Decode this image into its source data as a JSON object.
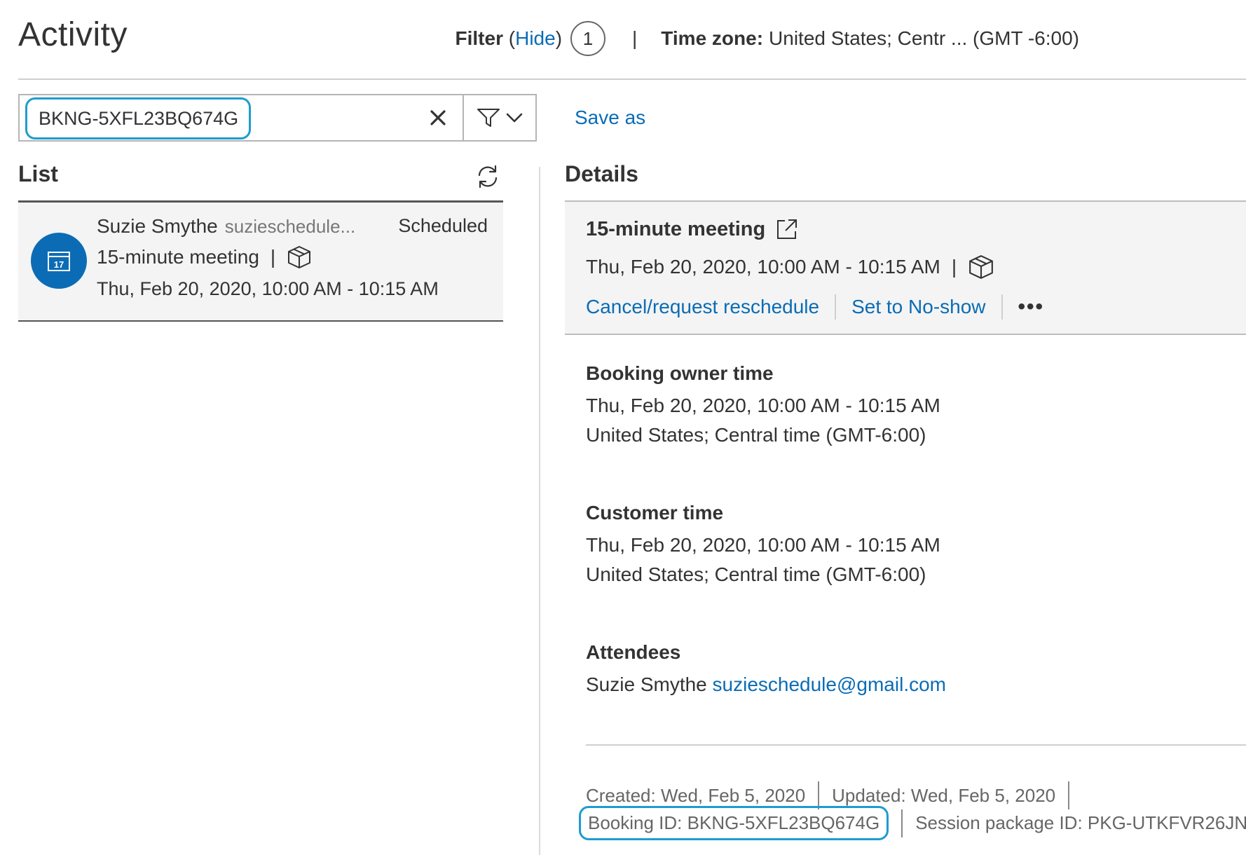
{
  "header": {
    "title": "Activity",
    "filter_label": "Filter",
    "filter_toggle": "Hide",
    "filter_count": "1",
    "separator": "|",
    "timezone_label": "Time zone:",
    "timezone_value": "United States; Centr ... (GMT -6:00)"
  },
  "search": {
    "value": "BKNG-5XFL23BQ674G",
    "clear_icon": "close-icon",
    "filter_icon": "filter-icon",
    "save_as": "Save as"
  },
  "list": {
    "title": "List",
    "refresh_icon": "refresh-icon",
    "items": [
      {
        "name": "Suzie Smythe",
        "email": "suzieschedule...",
        "status": "Scheduled",
        "meeting": "15-minute meeting",
        "separator": "|",
        "date": "Thu, Feb 20, 2020, 10:00 AM - 10:15 AM",
        "avatar_day": "17",
        "avatar_icon": "calendar-icon",
        "package_icon": "package-icon"
      }
    ]
  },
  "details": {
    "title": "Details",
    "meeting_title": "15-minute meeting",
    "date": "Thu, Feb 20, 2020, 10:00 AM - 10:15 AM",
    "separator": "|",
    "actions": {
      "cancel": "Cancel/request reschedule",
      "no_show": "Set to No-show",
      "more": "•••"
    },
    "owner_time": {
      "heading": "Booking owner time",
      "date": "Thu, Feb 20, 2020, 10:00 AM - 10:15 AM",
      "timezone": "United States; Central time (GMT-6:00)"
    },
    "customer_time": {
      "heading": "Customer time",
      "date": "Thu, Feb 20, 2020, 10:00 AM - 10:15 AM",
      "timezone": "United States; Central time (GMT-6:00)"
    },
    "attendees": {
      "heading": "Attendees",
      "name": "Suzie Smythe",
      "email": "suzieschedule@gmail.com"
    },
    "footer": {
      "created": "Created: Wed, Feb 5, 2020",
      "updated": "Updated: Wed, Feb 5, 2020",
      "booking_id": "Booking ID: BKNG-5XFL23BQ674G",
      "package_id": "Session package ID: PKG-UTKFVR26JN"
    }
  },
  "colors": {
    "link": "#0b6cb5",
    "highlight": "#1e9cd0",
    "avatar": "#0b6cb5"
  }
}
